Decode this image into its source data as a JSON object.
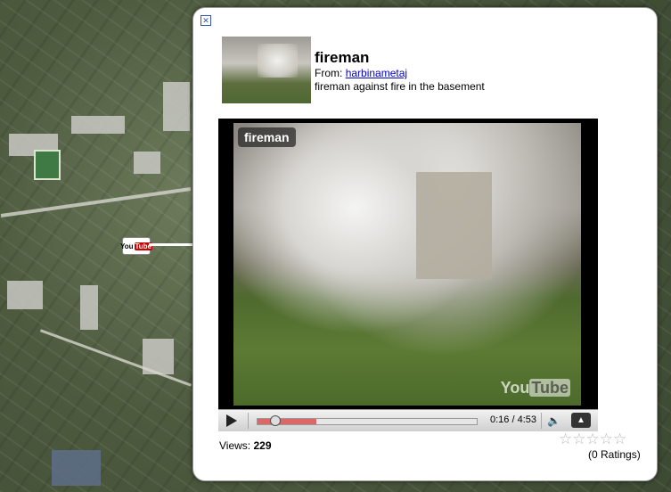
{
  "balloon": {
    "close_icon": "close-icon",
    "title": "fireman",
    "from_label": "From:",
    "from_user": "harbinametaj",
    "description": "fireman against fire in the basement",
    "player": {
      "overlay_title": "fireman",
      "logo_you": "You",
      "logo_tube": "Tube",
      "time": "0:16 / 4:53",
      "progress_fraction": 0.055,
      "loaded_fraction": 0.27
    },
    "views_label": "Views:",
    "views_value": "229",
    "stars": "☆☆☆☆☆",
    "ratings": "(0 Ratings)"
  },
  "map": {
    "marker_you": "You",
    "marker_tube": "Tube"
  }
}
